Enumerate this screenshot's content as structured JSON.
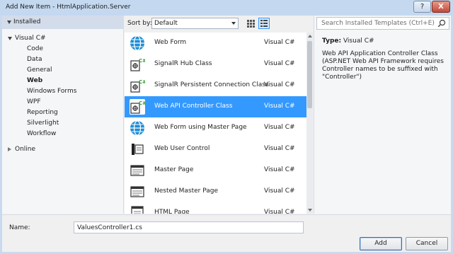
{
  "window": {
    "title": "Add New Item - HtmlApplication.Server",
    "help_label": "?",
    "close_label": "X"
  },
  "tree": {
    "header": "Installed",
    "root": "Visual C#",
    "children": [
      "Code",
      "Data",
      "General",
      "Web",
      "Windows Forms",
      "WPF",
      "Reporting",
      "Silverlight",
      "Workflow"
    ],
    "selected": "Web",
    "online": "Online"
  },
  "toolbar": {
    "sort_label": "Sort by:",
    "sort_value": "Default"
  },
  "templates": [
    {
      "name": "Web Form",
      "lang": "Visual C#",
      "icon": "globe-icon"
    },
    {
      "name": "SignalR Hub Class",
      "lang": "Visual C#",
      "icon": "signalr-class-icon"
    },
    {
      "name": "SignalR Persistent Connection Class",
      "lang": "Visual C#",
      "icon": "signalr-class-icon"
    },
    {
      "name": "Web API Controller Class",
      "lang": "Visual C#",
      "icon": "signalr-class-icon",
      "selected": true
    },
    {
      "name": "Web Form using Master Page",
      "lang": "Visual C#",
      "icon": "globe-icon"
    },
    {
      "name": "Web User Control",
      "lang": "Visual C#",
      "icon": "user-control-icon"
    },
    {
      "name": "Master Page",
      "lang": "Visual C#",
      "icon": "master-page-icon"
    },
    {
      "name": "Nested Master Page",
      "lang": "Visual C#",
      "icon": "master-page-icon"
    },
    {
      "name": "HTML Page",
      "lang": "Visual C#",
      "icon": "html-page-icon"
    }
  ],
  "details": {
    "search_placeholder": "Search Installed Templates (Ctrl+E)",
    "type_label": "Type:",
    "type_value": "Visual C#",
    "description": "Web API Application Controller Class (ASP.NET Web API Framework requires Controller names to be suffixed with \"Controller\")"
  },
  "bottom": {
    "name_label": "Name:",
    "name_value": "ValuesController1.cs",
    "add_label": "Add",
    "cancel_label": "Cancel"
  },
  "colors": {
    "selection": "#3399ff",
    "globe": "#1e8dd6",
    "badge": "#3a9b3a"
  }
}
